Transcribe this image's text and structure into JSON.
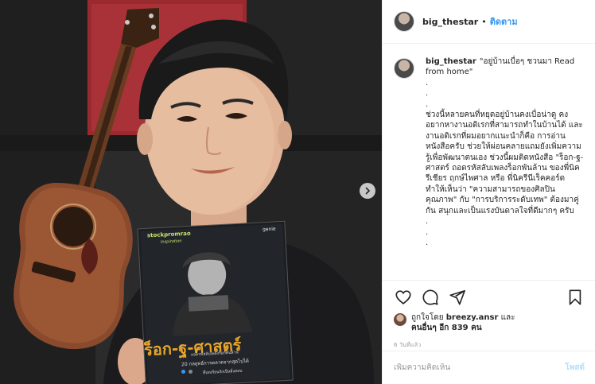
{
  "header": {
    "username": "big_thestar",
    "separator": "•",
    "follow_label": "ติดตาม"
  },
  "photo": {
    "book_brand": "stockpromrao",
    "book_subtitle": "Inspiration",
    "book_publisher": "genie",
    "book_title": "ร็อก-ฐ-ศาสตร์",
    "book_tagline": "ถอดรหัสลับเพลงร็อกพันล้าน",
    "book_line1": "20 กลยุทธ์การตลาดจากสุดไปได้",
    "book_line2": "ที่บทเรียนรักเป็นสิ่งสอน",
    "carousel_active": 1,
    "carousel_total": 2,
    "next_icon": "chevron-right-icon"
  },
  "caption": {
    "username": "big_thestar",
    "first_line": "\"อยู่บ้านเบื่อๆ ชวนมา Read from home\"",
    "dots": [
      ".",
      ".",
      "."
    ],
    "body": "ช่วงนี้หลายคนที่หยุดอยู่บ้านคงเบื่อน่าดู คงอยากหางานอดิเรกที่สามารถทำในบ้านได้ และงานอดิเรกที่ผมอยากแนะนำก็คือ การอ่านหนังสือครับ ช่วยให้ผ่อนคลายแถมยังเพิ่มความรู้เพื่อพัฒนาตนเอง ช่วงนี้ผมติดหนังสือ \"ร็อก-ฐ-ศาสตร์ ถอดรหัสลับเพลงร็อกพันล้าน ของพี่นิครีเชียร ฤกษ์ไพศาล หรือ พี่นิครีนีเร็คคอร์ด ทำให้เห็นว่า \"ความสามารถของศิลปินคุณภาพ\" กับ \"การบริการระดับเทพ\" ต้องมาคู่กัน สนุกและเป็นแรงบันดาลใจที่ดีมากๆ ครับ",
    "dots_after": [
      ".",
      ".",
      "."
    ]
  },
  "actions": {
    "like_icon": "heart-icon",
    "comment_icon": "comment-icon",
    "share_icon": "share-icon",
    "save_icon": "bookmark-icon"
  },
  "likes": {
    "prefix": "ถูกใจโดย",
    "liker": "breezy.ansr",
    "and": "และ",
    "others": "คนอื่นๆ อีก 839 คน"
  },
  "timestamp": "6 วันที่แล้ว",
  "comment": {
    "placeholder": "เพิ่มความคิดเห็น",
    "post_label": "โพสต์"
  },
  "colors": {
    "accent": "#3897f0",
    "post_disabled": "#b2dffc",
    "book_title": "#e8a52a",
    "book_brand": "#cfe36a"
  }
}
